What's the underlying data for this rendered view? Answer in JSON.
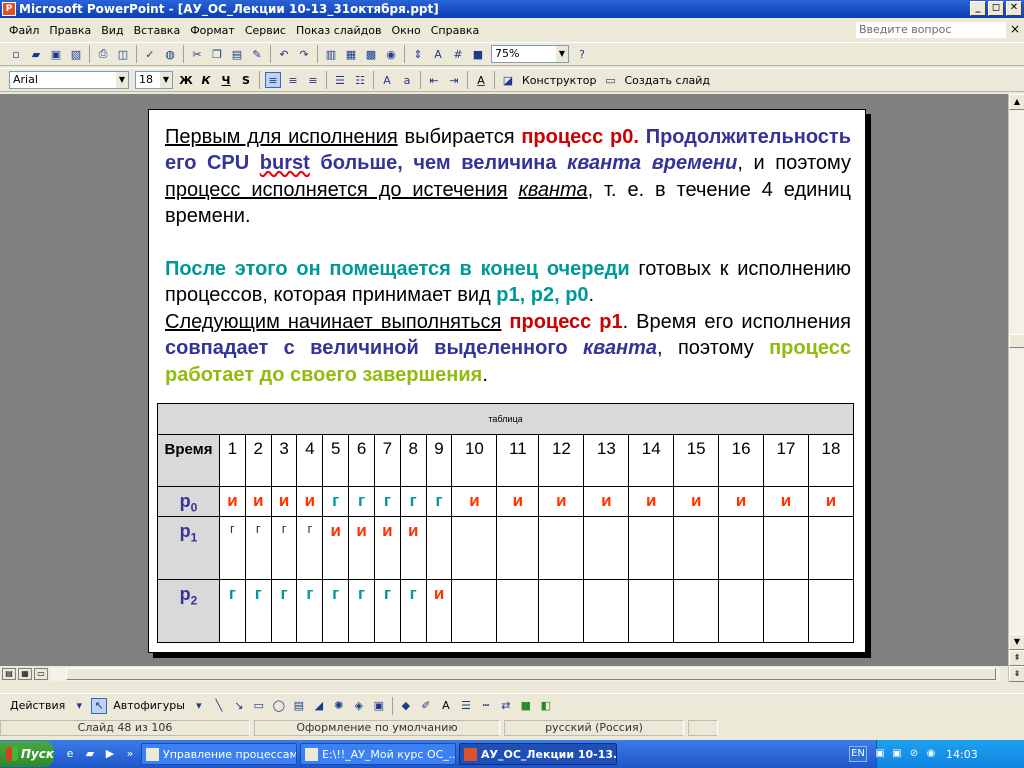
{
  "window": {
    "title": "Microsoft PowerPoint - [АУ_ОС_Лекции 10-13_31октября.ppt]",
    "controls": [
      "_",
      "◻",
      "✕"
    ]
  },
  "menu": {
    "items": [
      "Файл",
      "Правка",
      "Вид",
      "Вставка",
      "Формат",
      "Сервис",
      "Показ слайдов",
      "Окно",
      "Справка"
    ],
    "help_placeholder": "Введите вопрос",
    "close": "×"
  },
  "toolbar1": {
    "zoom": "75%"
  },
  "toolbar2": {
    "font": "Arial",
    "size": "18",
    "bold": "Ж",
    "italic": "К",
    "underline": "Ч",
    "shadow": "S",
    "designer": "Конструктор",
    "new_slide": "Создать слайд"
  },
  "slide": {
    "p1": {
      "a": "Первым для исполнения",
      "b": " выбирается ",
      "c": "процесс p0. Продолжительность его CPU burst больше, чем величина ",
      "c_red": "процесс p0.",
      "c_blue": " Продолжительность его CPU ",
      "c_burst": "burst",
      "c_blue2": " больше, чем величина ",
      "d": "кванта времени",
      "e": ", и поэтому ",
      "f": "процесс исполняется до истечения",
      "g": " ",
      "h": "кванта",
      "i": ", т. е. в течение 4 единиц времени."
    },
    "p2": {
      "a": "После этого он помещается в конец очереди",
      "b": " готовых к исполнению процессов, которая принимает вид ",
      "c": "p1, p2, p0",
      "d": "."
    },
    "p3": {
      "a": "Следующим начинает выполняться",
      "b": " ",
      "c": "процесс p1",
      "d": ". Время его исполнения ",
      "e": "совпадает с величиной выделенного ",
      "f": "кванта",
      "g": ", поэтому ",
      "h": "процесс работает до своего завершения",
      "i": "."
    }
  },
  "table": {
    "caption": "таблица",
    "header_label": "Время",
    "times": [
      "1",
      "2",
      "3",
      "4",
      "5",
      "6",
      "7",
      "8",
      "9",
      "10",
      "11",
      "12",
      "13",
      "14",
      "15",
      "16",
      "17",
      "18"
    ],
    "rows": [
      {
        "label": "p",
        "sub": "0",
        "cells": [
          "и",
          "и",
          "и",
          "и",
          "г",
          "г",
          "г",
          "г",
          "г",
          "и",
          "и",
          "и",
          "и",
          "и",
          "и",
          "и",
          "и",
          "и"
        ]
      },
      {
        "label": "p",
        "sub": "1",
        "cells": [
          "г",
          "г",
          "г",
          "г",
          "и",
          "и",
          "и",
          "и",
          "",
          "",
          "",
          "",
          "",
          "",
          "",
          "",
          "",
          ""
        ]
      },
      {
        "label": "p",
        "sub": "2",
        "cells": [
          "г",
          "г",
          "г",
          "г",
          "г",
          "г",
          "г",
          "г",
          "и",
          "",
          "",
          "",
          "",
          "",
          "",
          "",
          "",
          ""
        ]
      }
    ]
  },
  "drawbar": {
    "actions": "Действия",
    "autoshapes": "Автофигуры"
  },
  "status": {
    "slide": "Слайд 48 из 106",
    "design": "Оформление по умолчанию",
    "lang": "русский (Россия)"
  },
  "taskbar": {
    "start": "Пуск",
    "tasks": [
      {
        "label": "Управление процессам...",
        "active": false
      },
      {
        "label": "E:\\!!_АУ_Мой курс ОС_...",
        "active": false
      },
      {
        "label": "АУ_ОС_Лекции 10-13...",
        "active": true
      }
    ],
    "lang": "EN",
    "clock": "14:03"
  }
}
